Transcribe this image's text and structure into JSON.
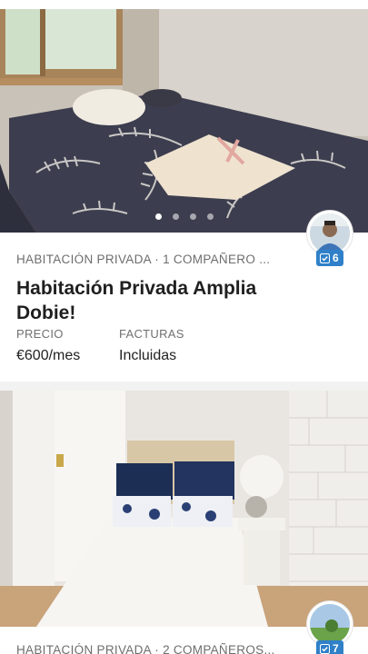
{
  "listings": [
    {
      "room_type": "HABITACIÓN PRIVADA · 1 COMPAÑERO ...",
      "title": "Habitación Privada Amplia Dobie!",
      "price_label": "PRECIO",
      "price_value": "€600/mes",
      "bills_label": "FACTURAS",
      "bills_value": "Incluidas",
      "verified_count": "6",
      "photo_index": 1,
      "photo_count": 4
    },
    {
      "room_type": "HABITACIÓN PRIVADA · 2 COMPAÑEROS...",
      "verified_count": "7"
    }
  ],
  "colors": {
    "badge": "#2f80c8",
    "divider": "#f2f2f2"
  }
}
